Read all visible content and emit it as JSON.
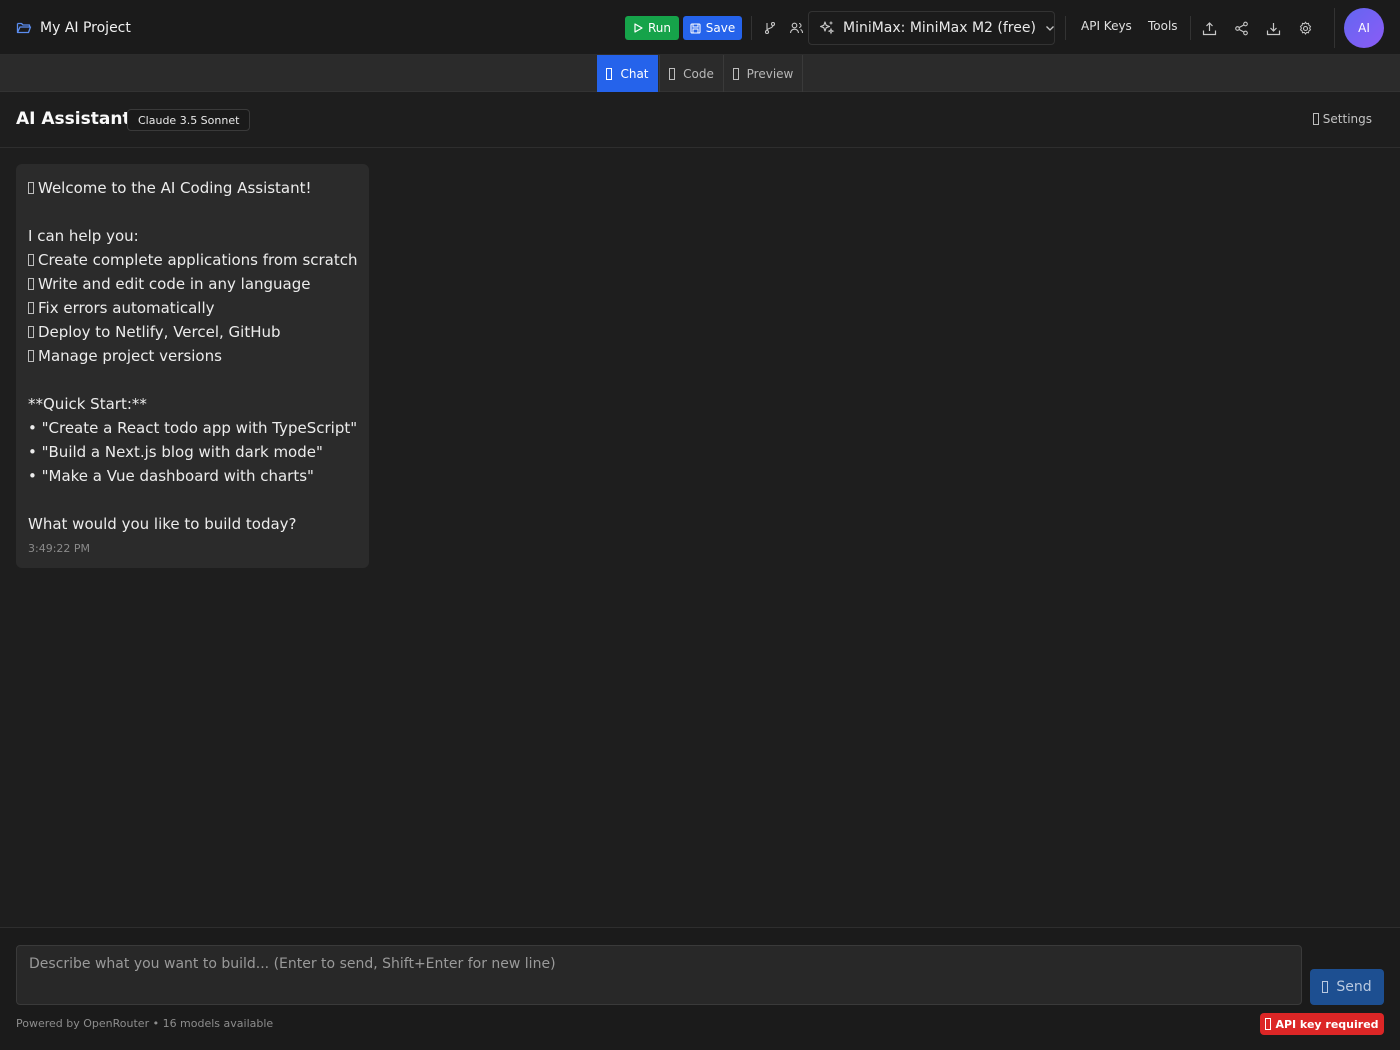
{
  "topbar": {
    "project_title": "My AI Project",
    "run_label": "Run",
    "save_label": "Save",
    "model_label": "MiniMax: MiniMax M2 (free)",
    "api_keys_label": "API Keys",
    "tools_label": "Tools",
    "avatar_initials": "AI"
  },
  "tabs": [
    {
      "label": "Chat",
      "active": true
    },
    {
      "label": "Code",
      "active": false
    },
    {
      "label": "Preview",
      "active": false
    }
  ],
  "header": {
    "title": "AI Assistant",
    "model_badge": "Claude 3.5 Sonnet",
    "settings_label": "Settings"
  },
  "message": {
    "lines": [
      "Welcome to the AI Coding Assistant!",
      "I can help you:",
      "Create complete applications from scratch",
      "Write and edit code in any language",
      "Fix errors automatically",
      "Deploy to Netlify, Vercel, GitHub",
      "Manage project versions",
      "**Quick Start:**",
      "• \"Create a React todo app with TypeScript\"",
      "• \"Build a Next.js blog with dark mode\"",
      "• \"Make a Vue dashboard with charts\"",
      "What would you like to build today?"
    ],
    "timestamp": "3:49:22 PM"
  },
  "footer": {
    "prompt_placeholder": "Describe what you want to build... (Enter to send, Shift+Enter for new line)",
    "send_label": "Send",
    "powered_by": "Powered by OpenRouter • 16 models available",
    "api_key_warning": "API key required"
  },
  "colors": {
    "run": "#16a34a",
    "save": "#2563eb",
    "active_tab": "#2563eb",
    "send": "#1d4f91",
    "warning": "#dc2626",
    "avatar_from": "#6366f1",
    "avatar_to": "#8b5cf6"
  },
  "icons": {
    "project": "folder-open-icon",
    "run": "play-icon",
    "save": "save-icon",
    "branch": "git-branch-icon",
    "users": "users-icon",
    "model": "sparkles-icon",
    "dropdown": "chevron-down-icon",
    "export": "upload-icon",
    "share": "share-icon",
    "download": "download-icon",
    "settings": "gear-icon"
  }
}
